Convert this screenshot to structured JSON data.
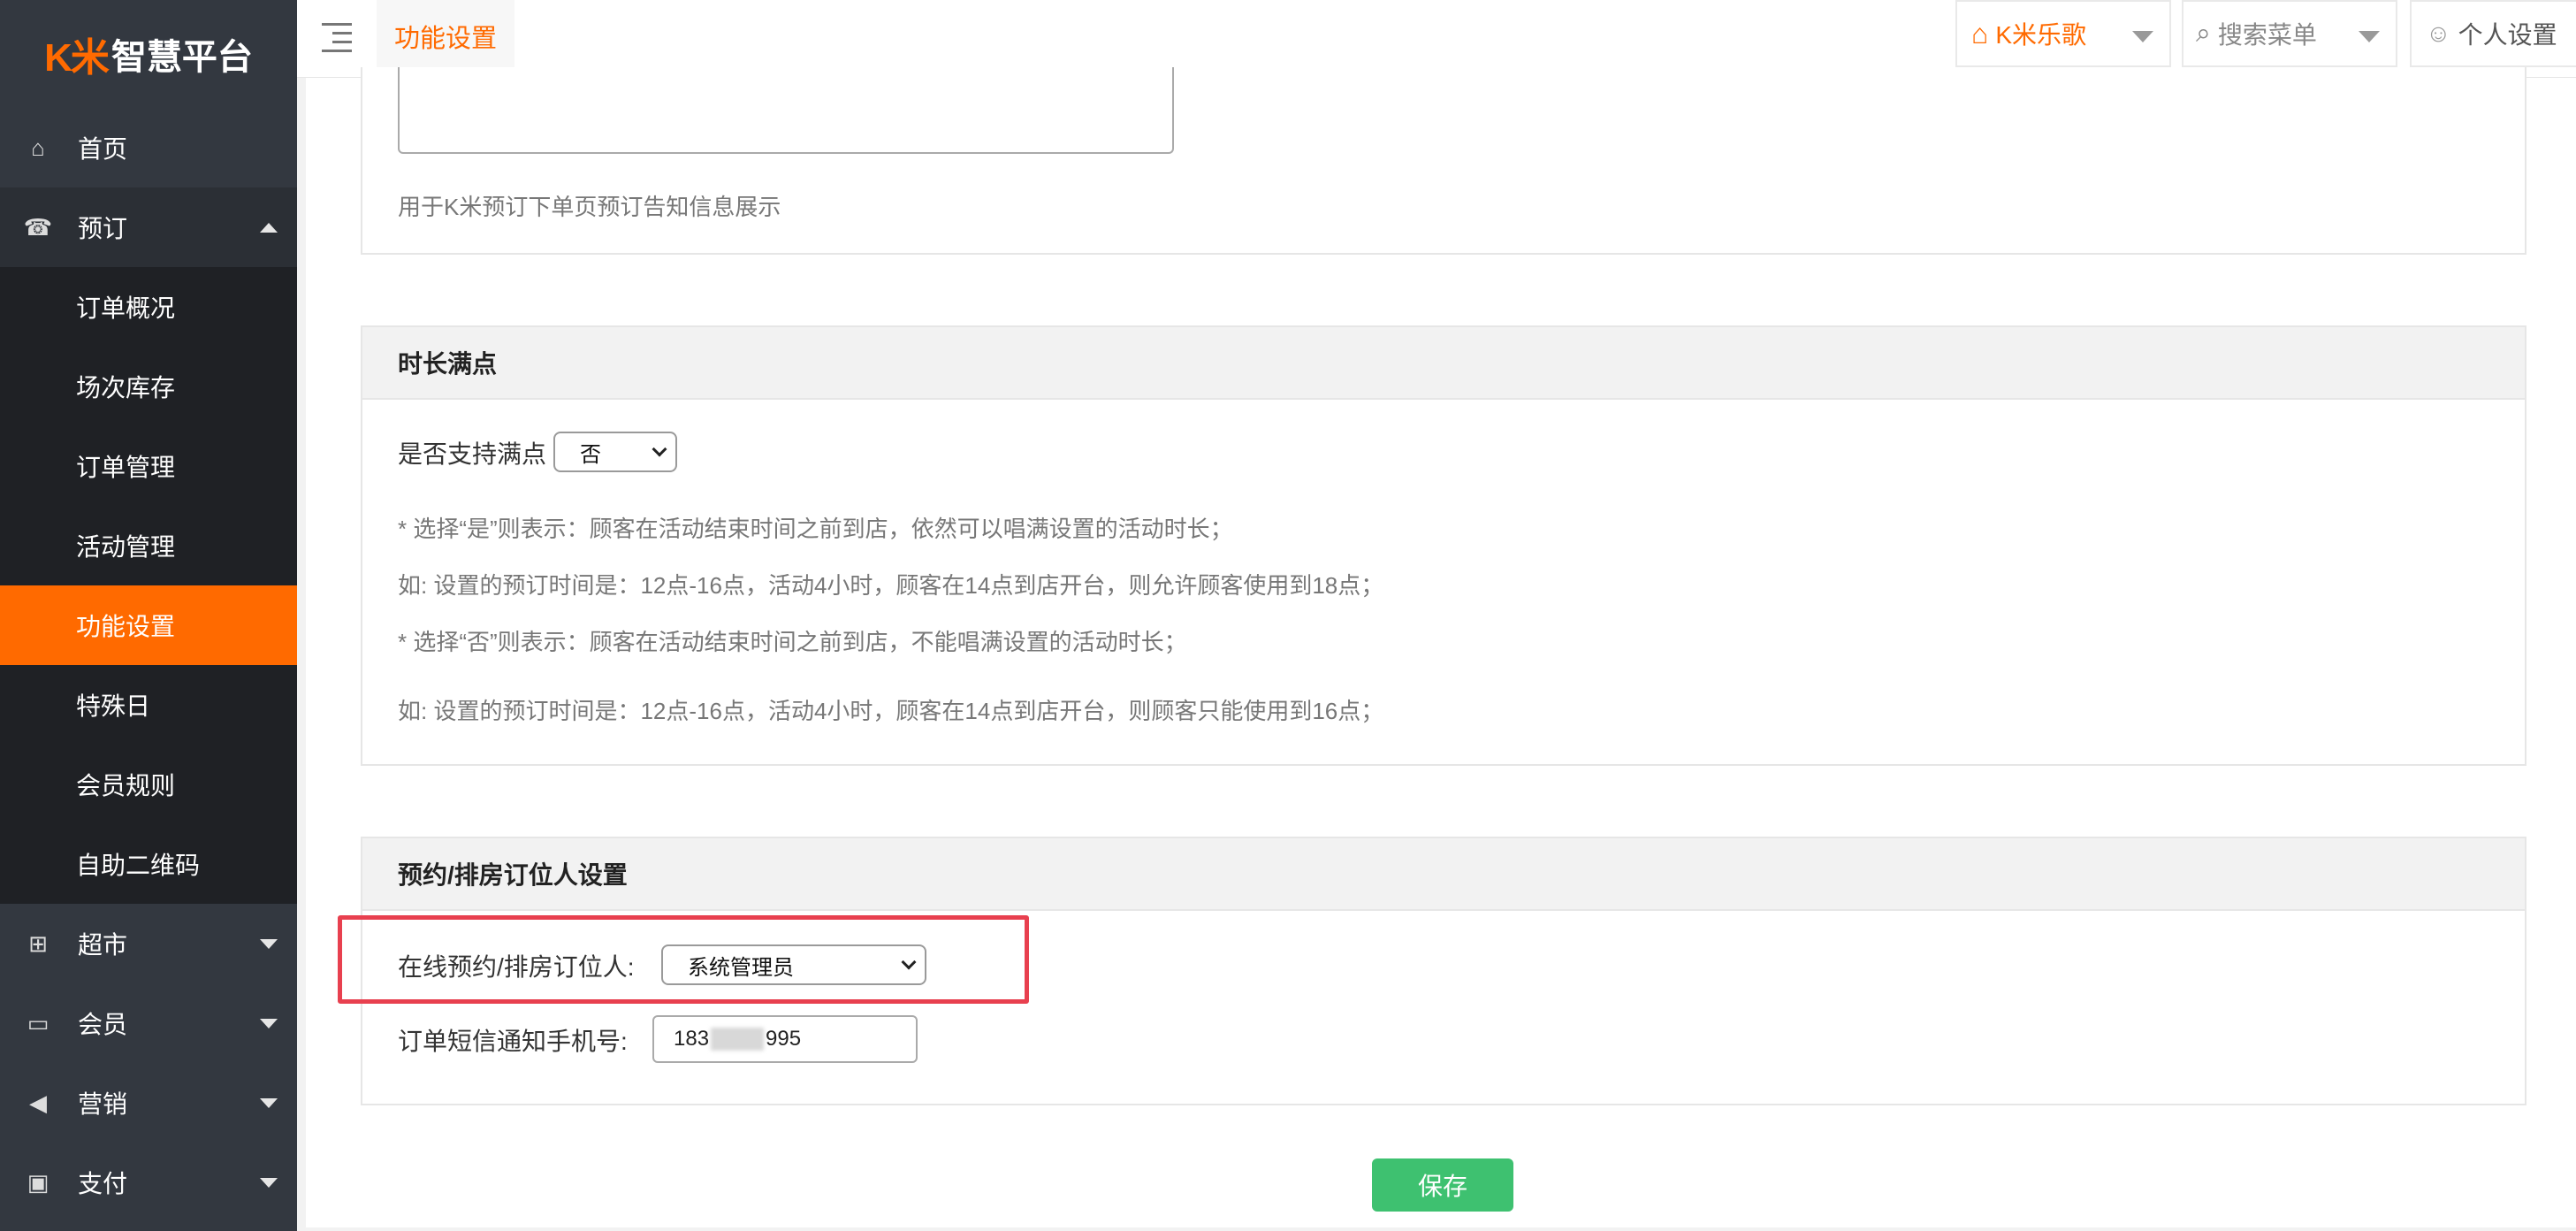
{
  "brand": {
    "mark": "K米",
    "name": "智慧平台"
  },
  "sidebar": {
    "items": [
      {
        "label": "首页",
        "icon": "home-icon",
        "glyph": "⌂"
      },
      {
        "label": "预订",
        "icon": "booking-icon",
        "glyph": "☎",
        "expanded": true
      },
      {
        "label": "超市",
        "icon": "basket-icon",
        "glyph": "⊞"
      },
      {
        "label": "会员",
        "icon": "card-icon",
        "glyph": "▭"
      },
      {
        "label": "营销",
        "icon": "megaphone-icon",
        "glyph": "◀"
      },
      {
        "label": "支付",
        "icon": "money-icon",
        "glyph": "▣"
      }
    ],
    "sub_items": [
      {
        "label": "订单概况"
      },
      {
        "label": "场次库存"
      },
      {
        "label": "订单管理"
      },
      {
        "label": "活动管理"
      },
      {
        "label": "功能设置",
        "active": true
      },
      {
        "label": "特殊日"
      },
      {
        "label": "会员规则"
      },
      {
        "label": "自助二维码"
      }
    ]
  },
  "topbar": {
    "active_tab": "功能设置",
    "store": "K米乐歌",
    "search_placeholder": "搜索菜单",
    "profile": "个人设置"
  },
  "notice_section": {
    "hint": "用于K米预订下单页预订告知信息展示"
  },
  "duration_section": {
    "title": "时长满点",
    "label": "是否支持满点",
    "value": "否",
    "notes": [
      "* 选择“是”则表示：顾客在活动结束时间之前到店，依然可以唱满设置的活动时长；",
      "如: 设置的预订时间是：12点-16点，活动4小时，顾客在14点到店开台，则允许顾客使用到18点；",
      "* 选择“否”则表示：顾客在活动结束时间之前到店，不能唱满设置的活动时长；",
      "如: 设置的预订时间是：12点-16点，活动4小时，顾客在14点到店开台，则顾客只能使用到16点；"
    ]
  },
  "booker_section": {
    "title": "预约/排房订位人设置",
    "booker_label": "在线预约/排房订位人:",
    "booker_value": "系统管理员",
    "phone_label": "订单短信通知手机号:",
    "phone_prefix": "183",
    "phone_suffix": "995"
  },
  "save_label": "保存",
  "colors": {
    "accent": "#ff6a00",
    "sidebar": "#333840",
    "save": "#3ec170",
    "highlight": "#e8404f"
  }
}
